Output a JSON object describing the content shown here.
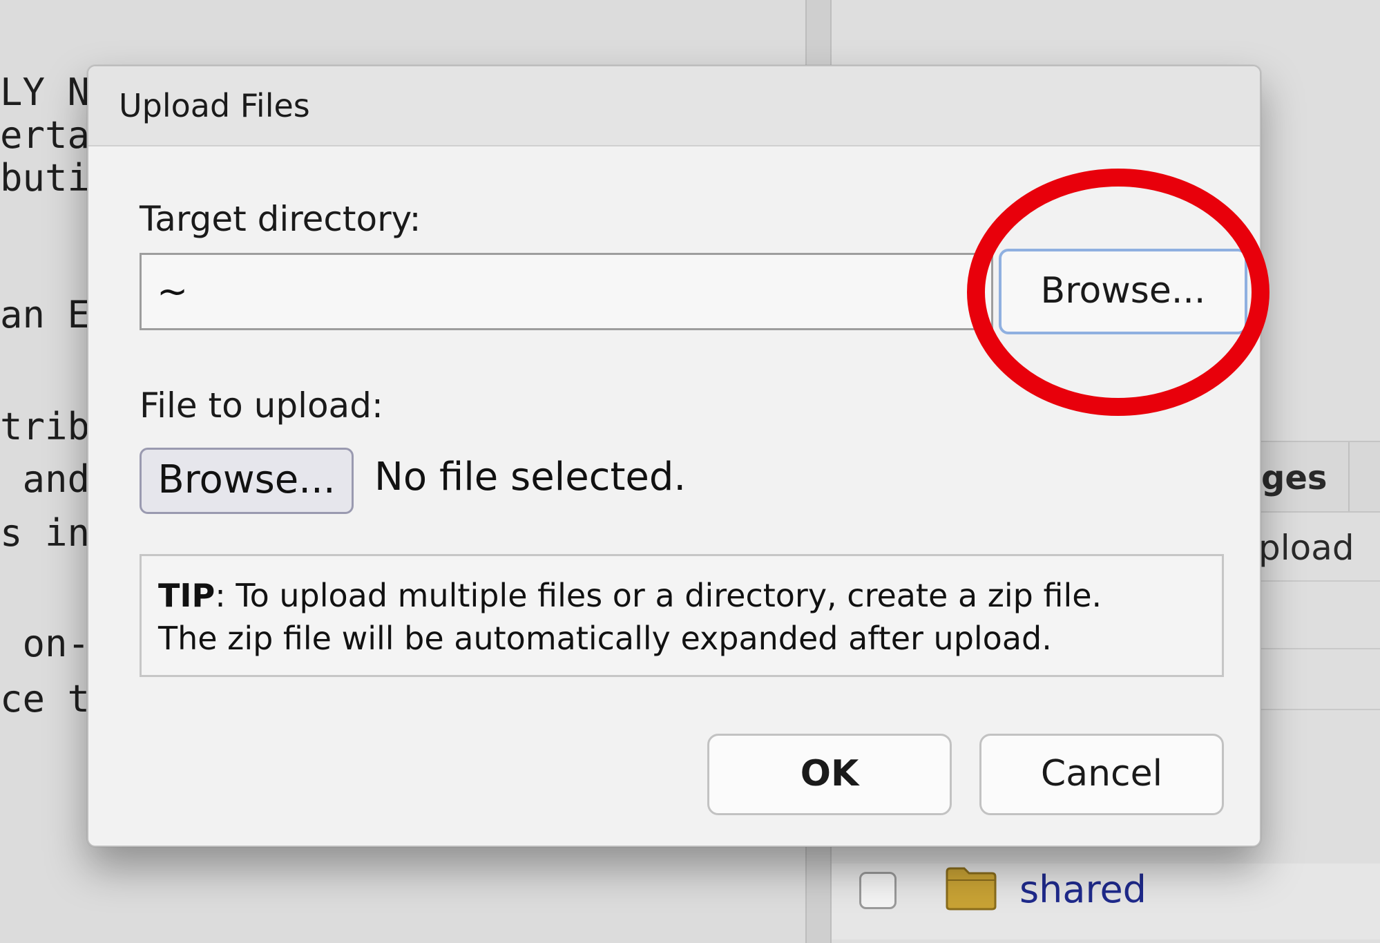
{
  "background": {
    "editor_lines": [
      "LY N",
      "erta",
      "buti",
      "an E",
      "trib",
      " and",
      "s in",
      " on-",
      "ce t"
    ],
    "right_pane": {
      "tab_label": "ges",
      "upload_label": "pload",
      "file_row": {
        "name": "shared",
        "icon": "folder-icon"
      }
    }
  },
  "dialog": {
    "title": "Upload Files",
    "target_directory_label": "Target directory:",
    "target_directory_value": "~",
    "target_browse_label": "Browse...",
    "file_label": "File to upload:",
    "file_browse_label": "Browse...",
    "file_status": "No file selected.",
    "tip": {
      "label": "TIP",
      "line1": ": To upload multiple files or a directory, create a zip file.",
      "line2": "The zip file will be automatically expanded after upload."
    },
    "ok_label": "OK",
    "cancel_label": "Cancel"
  },
  "annotation": {
    "shape": "ellipse",
    "color": "#e8000b",
    "target": "target-browse-button"
  },
  "colors": {
    "focus_ring": "#8fb0e0",
    "link": "#1f2a8c",
    "dialog_bg": "#f2f2f2",
    "header_bg": "#e4e4e4"
  }
}
